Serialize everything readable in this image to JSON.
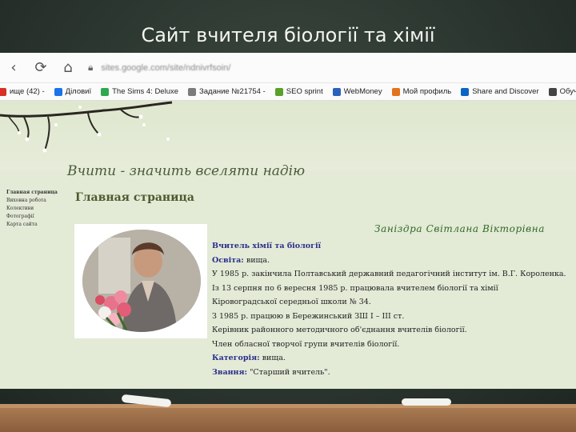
{
  "slide": {
    "title": "Сайт вчителя біології та хімії"
  },
  "browser": {
    "url": "sites.google.com/site/ndnivrfsoin/"
  },
  "bookmarks": [
    {
      "label": "ище (42) -",
      "icon": "mail-icon",
      "color": "#d93025"
    },
    {
      "label": "Діловиї",
      "icon": "page-icon",
      "color": "#1a73e8"
    },
    {
      "label": "The Sims 4: Deluxe",
      "icon": "sims-icon",
      "color": "#2fa84f"
    },
    {
      "label": "Задание №21754 -",
      "icon": "sp-icon",
      "color": "#7b7b7b"
    },
    {
      "label": "SEO sprint",
      "icon": "seo-icon",
      "color": "#5aa02c"
    },
    {
      "label": "WebMoney",
      "icon": "webmoney-icon",
      "color": "#2a62bc"
    },
    {
      "label": "Мой профиль",
      "icon": "profile-icon",
      "color": "#e3731b"
    },
    {
      "label": "Share and Discover",
      "icon": "linkedin-icon",
      "color": "#0a66c2"
    },
    {
      "label": "Обучение – Реален",
      "icon": "learn-icon",
      "color": "#444444"
    }
  ],
  "site": {
    "motto": "Вчити - значить вселяти надію",
    "sidenav": [
      "Главная страница",
      "Виховна робота",
      "Колективи",
      "Фотографії",
      "Карта сайта"
    ],
    "page_heading": "Главная страница",
    "teacher_name": "Заніздра  Світлана  Вікторівна",
    "bio": [
      {
        "label": "",
        "text": "Вчитель хімії та біології",
        "strong": true
      },
      {
        "label": "Освіта:",
        "text": " вища."
      },
      {
        "label": "",
        "text": "У 1985 р. закінчила  Полтавський державний педагогічний інститут ім. В.Г. Короленка."
      },
      {
        "label": "",
        "text": "Із 13 серпня по 6 вересня 1985 р. працювала вчителем біології та хімії"
      },
      {
        "label": "",
        "text": "Кіровоградської середньої школи № 34."
      },
      {
        "label": "",
        "text": "З 1985 р. працюю в Бережинський ЗШ I – III ст."
      },
      {
        "label": "",
        "text": "Керівник  районного методичного об'єднання вчителів біології."
      },
      {
        "label": "",
        "text": "Член обласної творчої групи вчителів біології."
      },
      {
        "label": "Категорія:",
        "text": " вища."
      },
      {
        "label": "Звання:",
        "text": " \"Старший вчитель\"."
      }
    ]
  }
}
